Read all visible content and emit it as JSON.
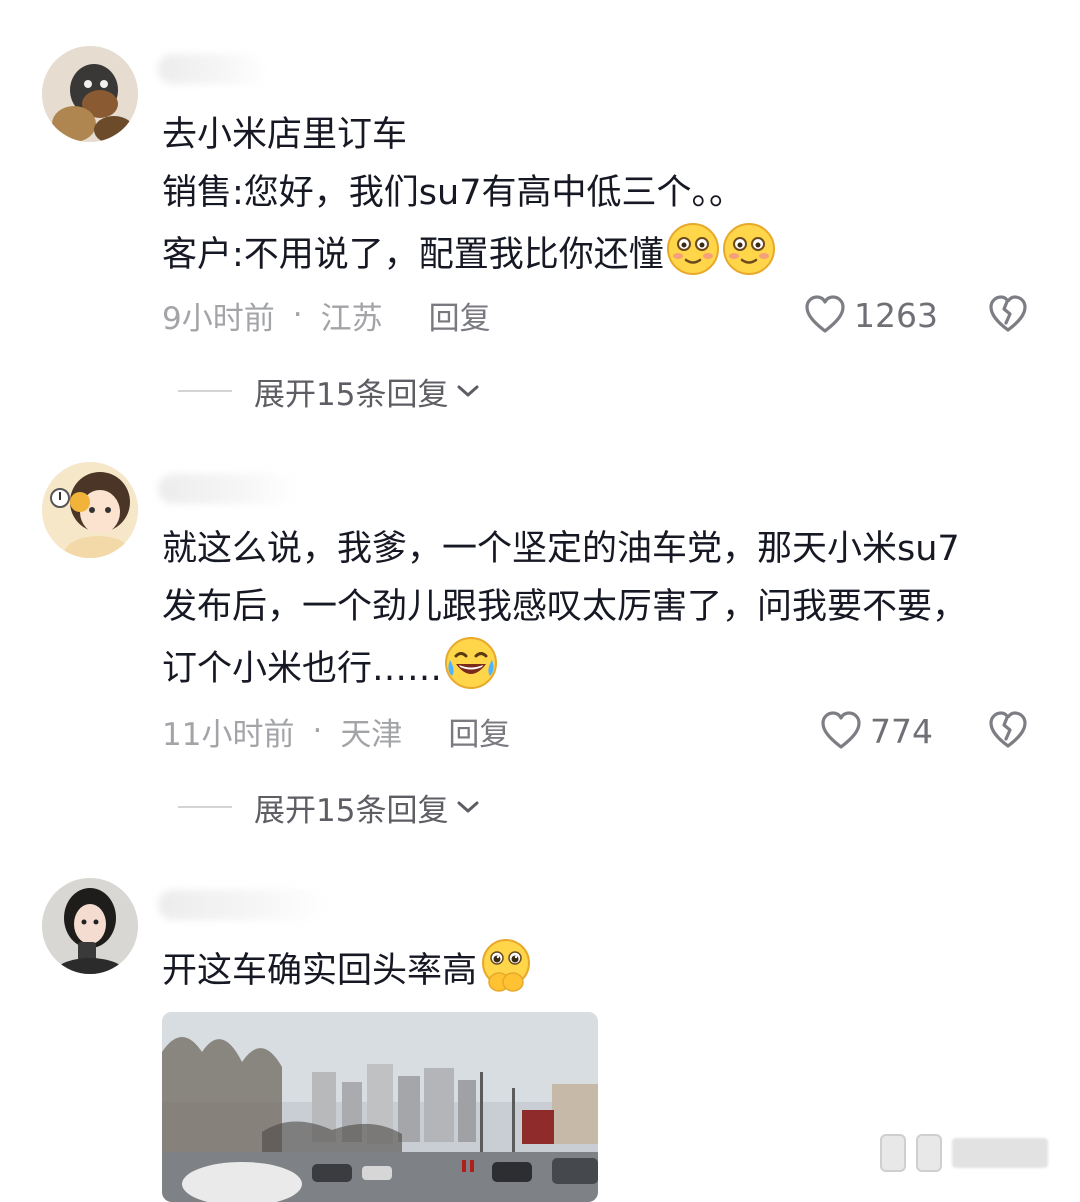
{
  "comments": [
    {
      "text": "去小米店里订车\n销售:您好，我们su7有高中低三个。。\n客户:不用说了，配置我比你还懂",
      "emojis": [
        "smiling-blush-emoji",
        "smiling-blush-emoji"
      ],
      "time": "9小时前",
      "location": "江苏",
      "reply_label": "回复",
      "likes": "1263",
      "expand_label": "展开15条回复"
    },
    {
      "text": "就这么说，我爹，一个坚定的油车党，那天小米su7\n发布后，一个劲儿跟我感叹太厉害了，问我要不要，\n订个小米也行……",
      "emojis": [
        "laughing-crying-emoji"
      ],
      "time": "11小时前",
      "location": "天津",
      "reply_label": "回复",
      "likes": "774",
      "expand_label": "展开15条回复"
    },
    {
      "text": "开这车确实回头率高",
      "emojis": [
        "pleading-hands-emoji"
      ],
      "has_photo": true
    }
  ],
  "separator": "·",
  "colors": {
    "text_primary": "#161823",
    "text_meta": "#a3a4a8",
    "text_expand": "#5d5e63",
    "icon_gray": "#7d7e83"
  }
}
